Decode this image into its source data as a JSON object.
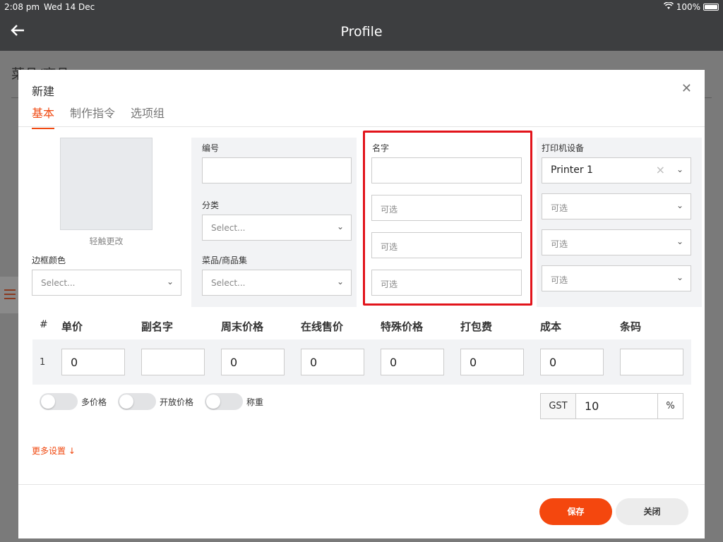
{
  "status": {
    "time": "2:08 pm",
    "date": "Wed 14 Dec",
    "battery": "100%"
  },
  "appbar": {
    "back_icon": "arrow-left-icon",
    "title": "Profile"
  },
  "background": {
    "title": "菜品/商品"
  },
  "modal": {
    "title": "新建",
    "close_icon": "close-icon",
    "tabs": [
      {
        "label": "基本",
        "active": true
      },
      {
        "label": "制作指令",
        "active": false
      },
      {
        "label": "选项组",
        "active": false
      }
    ],
    "image_caption": "轻触更改",
    "border_color": {
      "label": "边框颜色",
      "placeholder": "Select..."
    },
    "code": {
      "label": "编号",
      "value": ""
    },
    "category": {
      "label": "分类",
      "placeholder": "Select..."
    },
    "item_set": {
      "label": "菜品/商品集",
      "placeholder": "Select..."
    },
    "name": {
      "label": "名字",
      "value": "",
      "optional": [
        "可选",
        "可选",
        "可选"
      ]
    },
    "printer": {
      "label": "打印机设备",
      "value": "Printer 1",
      "optional": [
        "可选",
        "可选",
        "可选"
      ]
    },
    "table": {
      "headers": [
        "#",
        "单价",
        "副名字",
        "周末价格",
        "在线售价",
        "特殊价格",
        "打包费",
        "成本",
        "条码"
      ],
      "rows": [
        {
          "num": "1",
          "cells": [
            "0",
            "",
            "0",
            "0",
            "0",
            "0",
            "0",
            ""
          ]
        }
      ]
    },
    "toggles": [
      "多价格",
      "开放价格",
      "称重"
    ],
    "gst": {
      "label": "GST",
      "value": "10",
      "unit": "%"
    },
    "more_settings": "更多设置 ↓",
    "buttons": {
      "save": "保存",
      "close": "关闭"
    },
    "accent_color": "#f4470e",
    "highlight_color": "#e2141b"
  }
}
